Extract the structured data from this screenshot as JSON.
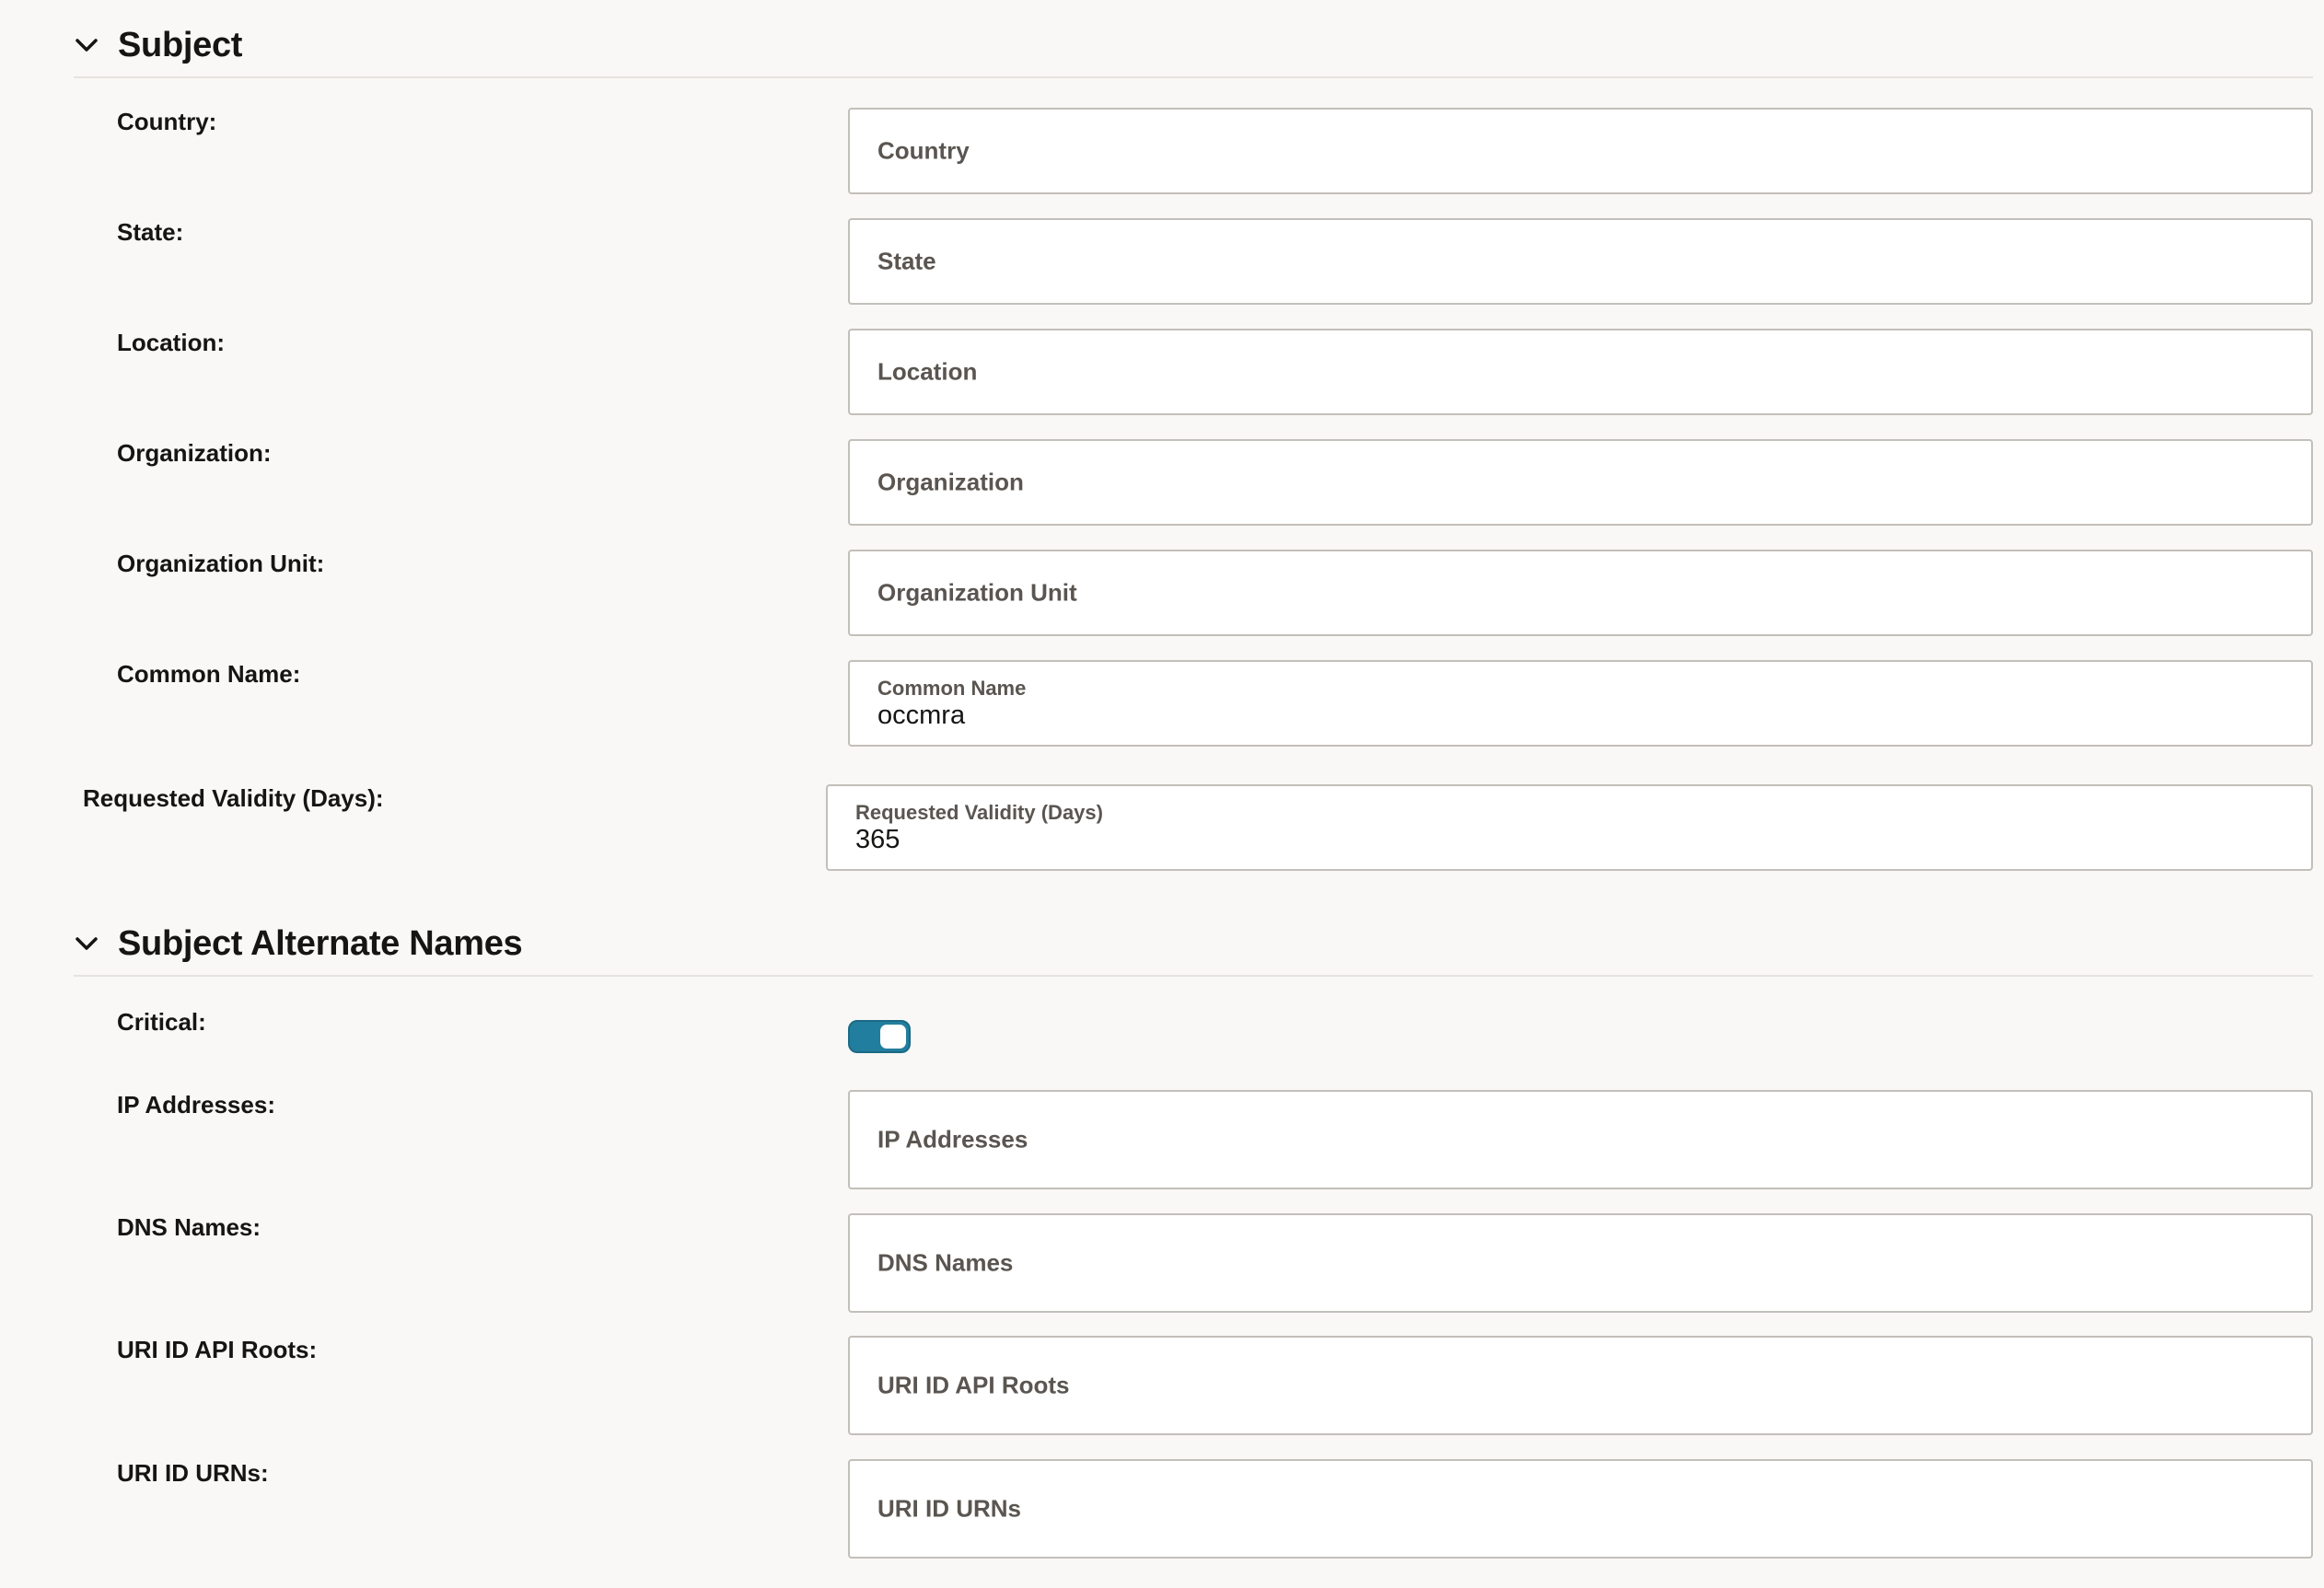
{
  "subject": {
    "title": "Subject",
    "fields": [
      {
        "label": "Country:",
        "placeholder": "Country"
      },
      {
        "label": "State:",
        "placeholder": "State"
      },
      {
        "label": "Location:",
        "placeholder": "Location"
      },
      {
        "label": "Organization:",
        "placeholder": "Organization"
      },
      {
        "label": "Organization Unit:",
        "placeholder": "Organization Unit"
      },
      {
        "label": "Common Name:",
        "float_label": "Common Name",
        "value": "occmra"
      }
    ]
  },
  "validity": {
    "label": "Requested Validity (Days):",
    "float_label": "Requested Validity (Days)",
    "value": "365"
  },
  "san": {
    "title": "Subject Alternate Names",
    "critical_label": "Critical:",
    "critical_on": true,
    "fields": [
      {
        "label": "IP Addresses:",
        "placeholder": "IP Addresses"
      },
      {
        "label": "DNS Names:",
        "placeholder": "DNS Names"
      },
      {
        "label": "URI ID API Roots:",
        "placeholder": "URI ID API Roots"
      },
      {
        "label": "URI ID URNs:",
        "placeholder": "URI ID URNs"
      }
    ]
  },
  "colors": {
    "toggle_on": "#227e9e",
    "background": "#f9f8f6"
  },
  "icons": {
    "section_toggle": "chevron-down-icon"
  }
}
